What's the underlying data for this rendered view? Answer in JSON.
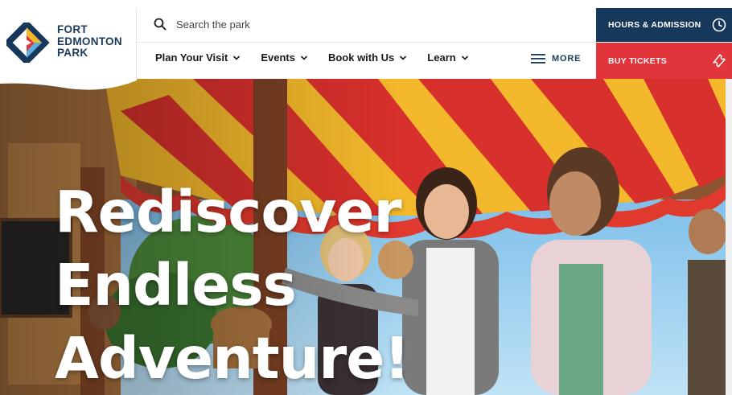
{
  "brand": {
    "name_lines": [
      "FORT",
      "EDMONTON",
      "PARK"
    ],
    "colors": {
      "navy": "#16385a",
      "red": "#e2343b",
      "yellow": "#f3b82b"
    }
  },
  "search": {
    "placeholder": "Search the park",
    "icon": "search-icon"
  },
  "nav": {
    "items": [
      {
        "label": "Plan Your Visit"
      },
      {
        "label": "Events"
      },
      {
        "label": "Book with Us"
      },
      {
        "label": "Learn"
      }
    ],
    "more_label": "MORE"
  },
  "cta": {
    "hours_label": "HOURS & ADMISSION",
    "tickets_label": "BUY TICKETS"
  },
  "hero": {
    "title_lines": [
      "Rediscover",
      "Endless",
      "Adventure!"
    ]
  }
}
